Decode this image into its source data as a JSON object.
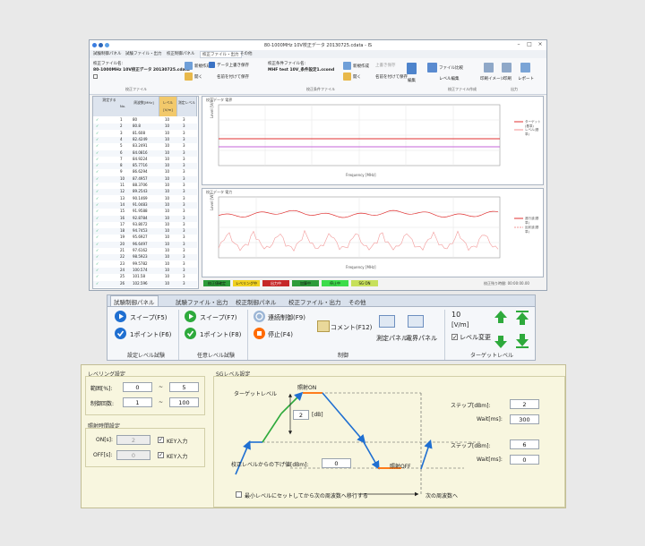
{
  "window": {
    "title": "80-1000MHz 10V校正データ 20130725.cdata - IS",
    "menu": [
      "試験制御パネル",
      "試験ファイル・出力",
      "校正制御パネル",
      "校正ファイル・出力",
      "その他"
    ],
    "ribbon": {
      "file_label": "校正ファイル名:",
      "file_name": "80-1000MHz 10V校正データ 20130725.cdata",
      "new_label": "新規作成",
      "save_label": "データ上書き保存",
      "open_label": "開く",
      "saveas_label": "名前を付けて保存",
      "cond_label": "校正条件ファイル名:",
      "cond_name": "MHF test 10V_条件設定1.ccond",
      "cond_new": "新規作成",
      "cond_save": "上書き保存",
      "cond_open": "開く",
      "cond_saveas": "名前を付けて保存",
      "edit_label": "編集",
      "file_list": "ファイル比較",
      "level_edit": "レベル編集",
      "print": "印刷イメージ",
      "print2": "印刷",
      "report": "レポート",
      "sec1": "校正ファイル",
      "sec2": "校正条件ファイル",
      "sec3": "校正ファイル作成",
      "sec4": "出力"
    },
    "table": {
      "section": "校正ファイル",
      "headers": [
        "測定する",
        "No.",
        "周波数[MHz]",
        "レベル[V/m]",
        "測定レベル"
      ],
      "rows": [
        [
          "1",
          "80",
          "10",
          "3"
        ],
        [
          "2",
          "80.8",
          "10",
          "3"
        ],
        [
          "3",
          "81.608",
          "10",
          "3"
        ],
        [
          "4",
          "82.4249",
          "10",
          "3"
        ],
        [
          "5",
          "83.2491",
          "10",
          "3"
        ],
        [
          "6",
          "84.0816",
          "10",
          "3"
        ],
        [
          "7",
          "84.9224",
          "10",
          "3"
        ],
        [
          "8",
          "85.7716",
          "10",
          "3"
        ],
        [
          "9",
          "86.6294",
          "10",
          "3"
        ],
        [
          "10",
          "87.4957",
          "10",
          "3"
        ],
        [
          "11",
          "88.3706",
          "10",
          "3"
        ],
        [
          "12",
          "89.2543",
          "10",
          "3"
        ],
        [
          "13",
          "90.1469",
          "10",
          "3"
        ],
        [
          "14",
          "91.0483",
          "10",
          "3"
        ],
        [
          "15",
          "91.9588",
          "10",
          "3"
        ],
        [
          "16",
          "92.8784",
          "10",
          "3"
        ],
        [
          "17",
          "93.8072",
          "10",
          "3"
        ],
        [
          "18",
          "94.7453",
          "10",
          "3"
        ],
        [
          "19",
          "95.6927",
          "10",
          "3"
        ],
        [
          "20",
          "96.6497",
          "10",
          "3"
        ],
        [
          "21",
          "97.6162",
          "10",
          "3"
        ],
        [
          "22",
          "98.5923",
          "10",
          "3"
        ],
        [
          "23",
          "99.5782",
          "10",
          "3"
        ],
        [
          "24",
          "100.574",
          "10",
          "3"
        ],
        [
          "25",
          "101.58",
          "10",
          "3"
        ],
        [
          "26",
          "102.596",
          "10",
          "3"
        ]
      ]
    },
    "chart1": {
      "title": "校正データ 電界",
      "xlabel": "Frequency [MHz]",
      "ylabel": "Level [V/m]",
      "legend": [
        "ターゲット(基準)",
        "レベル(基準)"
      ]
    },
    "chart2": {
      "title": "校正データ 電力",
      "xlabel": "Frequency [MHz]",
      "ylabel": "Level [W]",
      "legend": [
        "進行波(基準)",
        "反射波(基準)"
      ]
    },
    "status": {
      "buttons": [
        "校正値確定",
        "レベリング中",
        "出力中",
        "加算中",
        "停止中",
        "SG ON"
      ],
      "right": "校正残り時間:   00:00:00.00"
    }
  },
  "toolbar": {
    "tabs": [
      "試験制御パネル",
      "試験ファイル・出力",
      "校正制御パネル",
      "校正ファイル・出力",
      "その他"
    ],
    "sweep_f5": "スイープ(F5)",
    "point_f6": "1ポイント(F6)",
    "sec_set": "設定レベル試験",
    "sweep_f7": "スイープ(F7)",
    "point_f8": "1ポイント(F8)",
    "sec_any": "任意レベル試験",
    "continuous": "連続制御(F9)",
    "stop": "停止(F4)",
    "comment": "コメント(F12)",
    "meas_panel": "測定パネル",
    "mon_panel": "電界パネル",
    "sec_ctrl": "制御",
    "target_value": "10",
    "target_unit": "[V/m]",
    "level_change": "レベル変更",
    "sec_target": "ターゲットレベル"
  },
  "settings": {
    "leveling": {
      "title": "レベリング設定",
      "range_label": "範囲[%]:",
      "range_from": "0",
      "range_to": "5",
      "tilde": "~",
      "count_label": "制御回数:",
      "count_from": "1",
      "count_to": "100"
    },
    "dwell": {
      "title": "照射時間設定",
      "on_label": "ON[s]:",
      "on_value": "2",
      "off_label": "OFF[s]:",
      "off_value": "0",
      "key_on": "KEY入力",
      "key_off": "KEY入力"
    },
    "sg": {
      "title": "SGレベル設定",
      "target_level": "ターゲットレベル",
      "irradiation_on": "照射ON",
      "irradiation_off": "照射OFF",
      "db_value": "2",
      "db_unit": "[dB]",
      "drop_label": "校正レベルからの下げ値[dBm]:",
      "drop_value": "0",
      "step1_label": "ステップ[dBm]:",
      "step1_value": "2",
      "wait1_label": "Wait[ms]:",
      "wait1_value": "300",
      "step2_label": "ステップ[dBm]:",
      "step2_value": "6",
      "wait2_label": "Wait[ms]:",
      "wait2_value": "0",
      "min_check_label": "最小レベルにセットしてから次の周波数へ移行する",
      "next_freq": "次の周波数へ"
    }
  },
  "colors": {
    "accent_blue": "#1f6fd1",
    "green": "#2eaa3c",
    "red": "#e03030",
    "orange": "#ff6a00"
  }
}
